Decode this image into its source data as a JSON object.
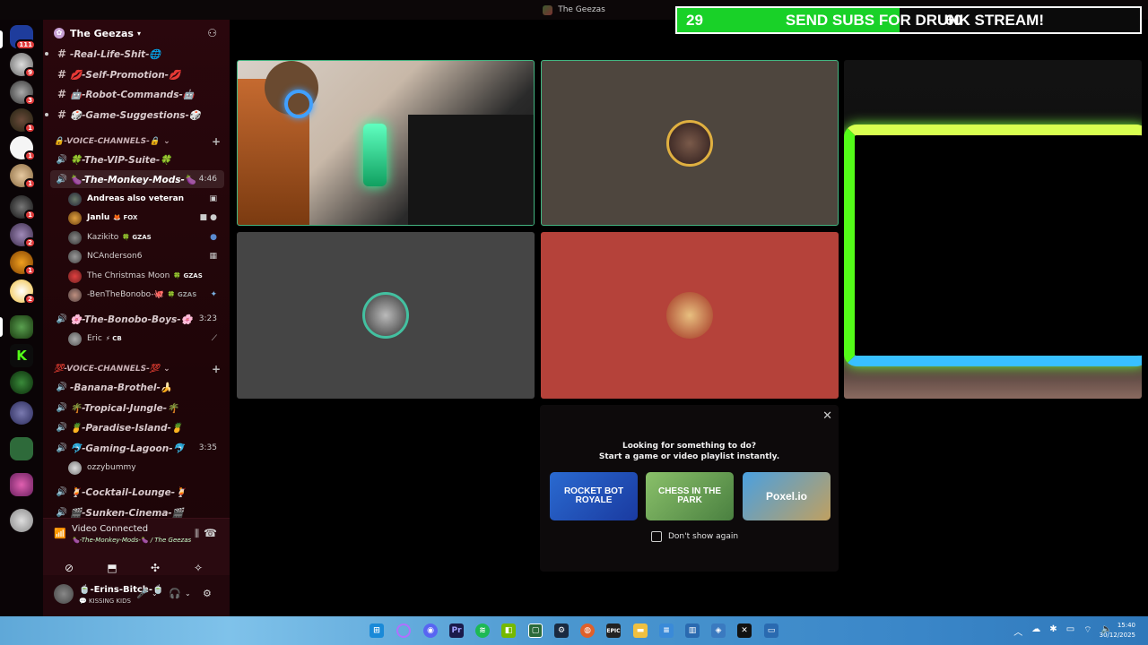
{
  "window": {
    "title": "The Geezas"
  },
  "server": {
    "name": "The Geezas"
  },
  "rail_badges": [
    "111",
    "9",
    "3",
    "1",
    "1",
    "1",
    "1",
    "2",
    "1",
    "2"
  ],
  "text_channels": [
    {
      "name": "-Real-Life-Shit-🌐"
    },
    {
      "name": "💋-Self-Promotion-💋"
    },
    {
      "name": "🤖-Robot-Commands-🤖"
    },
    {
      "name": "🎲-Game-Suggestions-🎲"
    }
  ],
  "category_1": {
    "label": "🔒-VOICE-CHANNELS-🔒"
  },
  "vip_channel": {
    "name": "🍀-The-VIP-Suite-🍀"
  },
  "monkey_channel": {
    "name": "🍆-The-Monkey-Mods-🍆",
    "time": "4:46"
  },
  "monkey_users": [
    {
      "name": "Andreas also veteran",
      "tag": ""
    },
    {
      "name": "Janlu",
      "tag": "🦊 FOX"
    },
    {
      "name": "Kazikito",
      "tag": "🍀 GZAS"
    },
    {
      "name": "NCAnderson6",
      "tag": ""
    },
    {
      "name": "The Christmas Moon",
      "tag": "🍀 GZAS"
    },
    {
      "name": "-BenTheBonobo-🐙",
      "tag": "🍀 GZAS"
    }
  ],
  "bonobo_channel": {
    "name": "🌸-The-Bonobo-Boys-🌸",
    "time": "3:23"
  },
  "bonobo_users": [
    {
      "name": "Eric",
      "tag": "⚡ CB"
    }
  ],
  "category_2": {
    "label": "💯-VOICE-CHANNELS-💯"
  },
  "voice_channels_2": [
    {
      "name": "-Banana-Brothel-🍌"
    },
    {
      "name": "🌴-Tropical-Jungle-🌴"
    },
    {
      "name": "🍍-Paradise-Island-🍍"
    }
  ],
  "lagoon_channel": {
    "name": "🐬-Gaming-Lagoon-🐬",
    "time": "3:35"
  },
  "lagoon_users": [
    {
      "name": "ozzybummy"
    }
  ],
  "more_channels": [
    {
      "name": "🍹-Cocktail-Lounge-🍹"
    },
    {
      "name": "🎬-Sunken-Cinema-🎬"
    }
  ],
  "voice_panel": {
    "status": "Video Connected",
    "channel": "🍆-The-Monkey-Mods-🍆 / The Geezas"
  },
  "user_panel": {
    "name": "🍵-Erins-Bitch-🍵",
    "status": "💬 KISSING KIDS"
  },
  "sub_goal": {
    "current": "29",
    "title": "SEND SUBS FOR DRUNK STREAM!",
    "goal": "60",
    "progress": 0.48,
    "fill_color": "#19d128"
  },
  "activity": {
    "line1": "Looking for something to do?",
    "line2": "Start a game or video playlist instantly.",
    "games": [
      {
        "title": "ROCKET BOT ROYALE"
      },
      {
        "title": "CHESS IN THE PARK"
      },
      {
        "title": "Poxel.io"
      }
    ],
    "checkbox_label": "Don't show again"
  },
  "clock": {
    "time": "15:40",
    "date": "30/12/2025"
  },
  "colors": {
    "speaking": "#43b581",
    "tile_red": "#b5423a",
    "tile_brown": "#4e463e",
    "tile_gray": "#454545"
  }
}
